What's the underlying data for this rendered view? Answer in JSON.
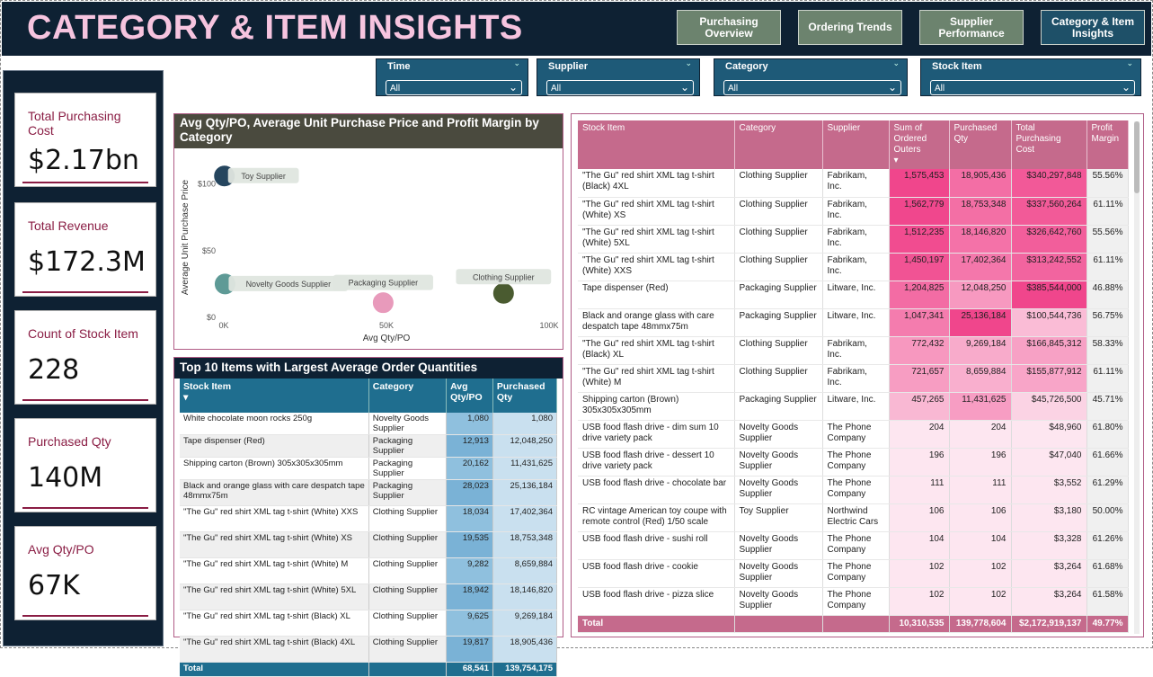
{
  "title": "CATEGORY & ITEM INSIGHTS",
  "nav": [
    {
      "label": "Purchasing Overview",
      "style": "green"
    },
    {
      "label": "Ordering Trends",
      "style": "green"
    },
    {
      "label": "Supplier Performance",
      "style": "green"
    },
    {
      "label": "Category & Item Insights",
      "style": "teal"
    }
  ],
  "slicers": [
    {
      "label": "Time",
      "value": "All"
    },
    {
      "label": "Supplier",
      "value": "All"
    },
    {
      "label": "Category",
      "value": "All"
    },
    {
      "label": "Stock Item",
      "value": "All"
    }
  ],
  "kpis": [
    {
      "label": "Total Purchasing Cost",
      "value": "$2.17bn"
    },
    {
      "label": "Total Revenue",
      "value": "$172.3M"
    },
    {
      "label": "Count of Stock Item",
      "value": "228"
    },
    {
      "label": "Purchased Qty",
      "value": "140M"
    },
    {
      "label": "Avg Qty/PO",
      "value": "67K"
    }
  ],
  "scatter": {
    "title": "Avg Qty/PO, Average Unit Purchase Price and Profit Margin by Category",
    "chart_data": {
      "type": "scatter",
      "xlabel": "Avg Qty/PO",
      "ylabel": "Average Unit Purchase Price",
      "xlim": [
        0,
        100000
      ],
      "ylim": [
        0,
        120
      ],
      "xticks": [
        "0K",
        "50K",
        "100K"
      ],
      "yticks": [
        "$0",
        "$50",
        "$100"
      ],
      "points": [
        {
          "label": "Toy Supplier",
          "x": 200,
          "y": 106,
          "color": "#25455e"
        },
        {
          "label": "Novelty Goods Supplier",
          "x": 400,
          "y": 25,
          "color": "#5e9a96"
        },
        {
          "label": "Packaging Supplier",
          "x": 49000,
          "y": 11,
          "color": "#e89abb"
        },
        {
          "label": "Clothing Supplier",
          "x": 86000,
          "y": 18,
          "color": "#4a5b30"
        }
      ]
    }
  },
  "top10": {
    "title": "Top 10 Items with Largest Average Order Quantities",
    "headers": [
      "Stock Item",
      "Category",
      "Avg Qty/PO",
      "Purchased Qty"
    ],
    "rows": [
      [
        "White chocolate moon rocks 250g",
        "Novelty Goods Supplier",
        "1,080",
        "1,080"
      ],
      [
        "Tape dispenser (Red)",
        "Packaging Supplier",
        "12,913",
        "12,048,250"
      ],
      [
        "Shipping carton (Brown) 305x305x305mm",
        "Packaging Supplier",
        "20,162",
        "11,431,625"
      ],
      [
        "Black and orange glass with care despatch tape 48mmx75m",
        "Packaging Supplier",
        "28,023",
        "25,136,184"
      ],
      [
        "\"The Gu\" red shirt XML tag t-shirt (White) XXS",
        "Clothing Supplier",
        "18,034",
        "17,402,364"
      ],
      [
        "\"The Gu\" red shirt XML tag t-shirt (White) XS",
        "Clothing Supplier",
        "19,535",
        "18,753,348"
      ],
      [
        "\"The Gu\" red shirt XML tag t-shirt (White) M",
        "Clothing Supplier",
        "9,282",
        "8,659,884"
      ],
      [
        "\"The Gu\" red shirt XML tag t-shirt (White) 5XL",
        "Clothing Supplier",
        "18,942",
        "18,146,820"
      ],
      [
        "\"The Gu\" red shirt XML tag t-shirt (Black) XL",
        "Clothing Supplier",
        "9,625",
        "9,269,184"
      ],
      [
        "\"The Gu\" red shirt XML tag t-shirt (Black) 4XL",
        "Clothing Supplier",
        "19,817",
        "18,905,436"
      ]
    ],
    "total": [
      "Total",
      "",
      "68,541",
      "139,754,175"
    ]
  },
  "big": {
    "headers": [
      "Stock Item",
      "Category",
      "Supplier",
      "Sum of Ordered Outers",
      "Purchased Qty",
      "Total Purchasing Cost",
      "Profit Margin"
    ],
    "rows": [
      [
        "\"The Gu\" red shirt XML tag t-shirt (Black) 4XL",
        "Clothing Supplier",
        "Fabrikam, Inc.",
        "1,575,453",
        "18,905,436",
        "$340,297,848",
        "55.56%"
      ],
      [
        "\"The Gu\" red shirt XML tag t-shirt (White) XS",
        "Clothing Supplier",
        "Fabrikam, Inc.",
        "1,562,779",
        "18,753,348",
        "$337,560,264",
        "61.11%"
      ],
      [
        "\"The Gu\" red shirt XML tag t-shirt (White) 5XL",
        "Clothing Supplier",
        "Fabrikam, Inc.",
        "1,512,235",
        "18,146,820",
        "$326,642,760",
        "55.56%"
      ],
      [
        "\"The Gu\" red shirt XML tag t-shirt (White) XXS",
        "Clothing Supplier",
        "Fabrikam, Inc.",
        "1,450,197",
        "17,402,364",
        "$313,242,552",
        "61.11%"
      ],
      [
        "Tape dispenser (Red)",
        "Packaging Supplier",
        "Litware, Inc.",
        "1,204,825",
        "12,048,250",
        "$385,544,000",
        "46.88%"
      ],
      [
        "Black and orange glass with care despatch tape 48mmx75m",
        "Packaging Supplier",
        "Litware, Inc.",
        "1,047,341",
        "25,136,184",
        "$100,544,736",
        "56.75%"
      ],
      [
        "\"The Gu\" red shirt XML tag t-shirt (Black) XL",
        "Clothing Supplier",
        "Fabrikam, Inc.",
        "772,432",
        "9,269,184",
        "$166,845,312",
        "58.33%"
      ],
      [
        "\"The Gu\" red shirt XML tag t-shirt (White) M",
        "Clothing Supplier",
        "Fabrikam, Inc.",
        "721,657",
        "8,659,884",
        "$155,877,912",
        "61.11%"
      ],
      [
        "Shipping carton (Brown) 305x305x305mm",
        "Packaging Supplier",
        "Litware, Inc.",
        "457,265",
        "11,431,625",
        "$45,726,500",
        "45.71%"
      ],
      [
        "USB food flash drive - dim sum 10 drive variety pack",
        "Novelty Goods Supplier",
        "The Phone Company",
        "204",
        "204",
        "$48,960",
        "61.80%"
      ],
      [
        "USB food flash drive - dessert 10 drive variety pack",
        "Novelty Goods Supplier",
        "The Phone Company",
        "196",
        "196",
        "$47,040",
        "61.66%"
      ],
      [
        "USB food flash drive - chocolate bar",
        "Novelty Goods Supplier",
        "The Phone Company",
        "111",
        "111",
        "$3,552",
        "61.29%"
      ],
      [
        "RC vintage American toy coupe with remote control (Red) 1/50 scale",
        "Toy Supplier",
        "Northwind Electric Cars",
        "106",
        "106",
        "$3,180",
        "50.00%"
      ],
      [
        "USB food flash drive - sushi roll",
        "Novelty Goods Supplier",
        "The Phone Company",
        "104",
        "104",
        "$3,328",
        "61.26%"
      ],
      [
        "USB food flash drive - cookie",
        "Novelty Goods Supplier",
        "The Phone Company",
        "102",
        "102",
        "$3,264",
        "61.68%"
      ],
      [
        "USB food flash drive - pizza slice",
        "Novelty Goods Supplier",
        "The Phone Company",
        "102",
        "102",
        "$3,264",
        "61.58%"
      ]
    ],
    "total": [
      "Total",
      "",
      "",
      "10,310,535",
      "139,778,604",
      "$2,172,919,137",
      "49.77%"
    ],
    "intensity": {
      "outers": [
        1575453,
        1562779,
        1512235,
        1450197,
        1204825,
        1047341,
        772432,
        721657,
        457265,
        204,
        196,
        111,
        106,
        104,
        102,
        102
      ],
      "qty": [
        18905436,
        18753348,
        18146820,
        17402364,
        12048250,
        25136184,
        9269184,
        8659884,
        11431625,
        204,
        196,
        111,
        106,
        104,
        102,
        102
      ],
      "cost": [
        340297848,
        337560264,
        326642760,
        313242552,
        385544000,
        100544736,
        166845312,
        155877912,
        45726500,
        48960,
        47040,
        3552,
        3180,
        3328,
        3264,
        3264
      ]
    }
  }
}
